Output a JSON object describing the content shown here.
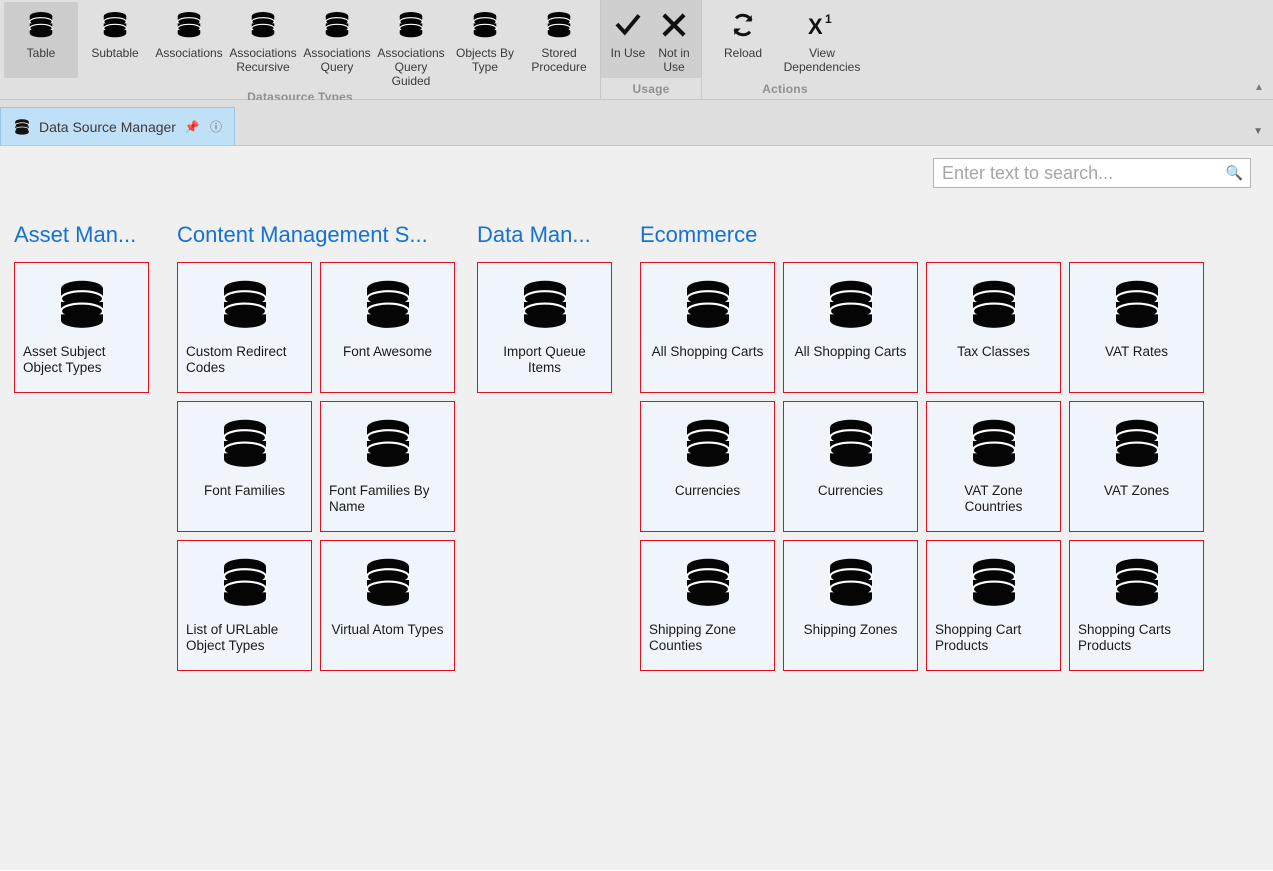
{
  "ribbon": {
    "groups": [
      {
        "label": "Datasource Types",
        "selected": false,
        "buttons": [
          {
            "label": "Table",
            "icon": "database-icon",
            "active": true
          },
          {
            "label": "Subtable",
            "icon": "database-icon",
            "active": false
          },
          {
            "label": "Associations",
            "icon": "database-icon",
            "active": false
          },
          {
            "label": "Associations Recursive",
            "icon": "database-icon",
            "active": false
          },
          {
            "label": "Associations Query",
            "icon": "database-icon",
            "active": false
          },
          {
            "label": "Associations Query Guided",
            "icon": "database-icon",
            "active": false
          },
          {
            "label": "Objects By Type",
            "icon": "database-icon",
            "active": false
          },
          {
            "label": "Stored Procedure",
            "icon": "database-icon",
            "active": false
          }
        ]
      },
      {
        "label": "Usage",
        "selected": true,
        "buttons": [
          {
            "label": "In Use",
            "icon": "checkmark-icon",
            "active": false
          },
          {
            "label": "Not in Use",
            "icon": "cross-icon",
            "active": false
          }
        ]
      },
      {
        "label": "Actions",
        "selected": false,
        "buttons": [
          {
            "label": "Reload",
            "icon": "refresh-icon",
            "active": false
          },
          {
            "label": "View Dependencies",
            "icon": "x-superscript-icon",
            "active": false
          }
        ]
      }
    ],
    "collapse_icon": "chevron-up-icon"
  },
  "tabbar": {
    "tab": {
      "title": "Data Source Manager",
      "icon": "database-icon",
      "pin_icon": "pin-icon",
      "close_icon": "close-icon"
    },
    "menu_icon": "chevron-down-icon"
  },
  "search": {
    "placeholder": "Enter text to search...",
    "value": "",
    "icon": "search-icon"
  },
  "colors": {
    "tile_border": "#e01020",
    "tile_fill": "#f0f5fc",
    "header_text": "#1572d4",
    "tab_active": "#bfe0f7",
    "ribbon_bg": "#e0e0e0",
    "content_bg": "#f0f0f0"
  },
  "columns": [
    {
      "header": "Asset Man...",
      "key": "col-asset",
      "tiles": [
        {
          "label": "Asset Subject Object Types",
          "icon": "database-icon",
          "align": "left"
        }
      ]
    },
    {
      "header": "Content Management S...",
      "key": "col-cms",
      "tiles": [
        {
          "label": "Custom Redirect Codes",
          "icon": "database-icon",
          "align": "left"
        },
        {
          "label": "Font Awesome",
          "icon": "database-icon",
          "align": "center"
        },
        {
          "label": "Font Families",
          "icon": "database-icon",
          "align": "center"
        },
        {
          "label": "Font Families By Name",
          "icon": "database-icon",
          "align": "left"
        },
        {
          "label": "List of URLable Object Types",
          "icon": "database-icon",
          "align": "left"
        },
        {
          "label": "Virtual Atom Types",
          "icon": "database-icon",
          "align": "center"
        }
      ]
    },
    {
      "header": "Data Man...",
      "key": "col-data",
      "tiles": [
        {
          "label": "Import Queue Items",
          "icon": "database-icon",
          "align": "center"
        }
      ]
    },
    {
      "header": "Ecommerce",
      "key": "col-ecom",
      "tiles": [
        {
          "label": "All Shopping Carts",
          "icon": "database-icon",
          "align": "center"
        },
        {
          "label": "All Shopping Carts",
          "icon": "database-icon",
          "align": "center"
        },
        {
          "label": "Tax Classes",
          "icon": "database-icon",
          "align": "center"
        },
        {
          "label": "VAT Rates",
          "icon": "database-icon",
          "align": "center"
        },
        {
          "label": "Currencies",
          "icon": "database-icon",
          "align": "center"
        },
        {
          "label": "Currencies",
          "icon": "database-icon",
          "align": "center"
        },
        {
          "label": "VAT Zone Countries",
          "icon": "database-icon",
          "align": "center"
        },
        {
          "label": "VAT Zones",
          "icon": "database-icon",
          "align": "center"
        },
        {
          "label": "Shipping Zone Counties",
          "icon": "database-icon",
          "align": "left"
        },
        {
          "label": "Shipping Zones",
          "icon": "database-icon",
          "align": "center"
        },
        {
          "label": "Shopping Cart Products",
          "icon": "database-icon",
          "align": "left"
        },
        {
          "label": "Shopping Carts Products",
          "icon": "database-icon",
          "align": "left"
        }
      ]
    }
  ]
}
